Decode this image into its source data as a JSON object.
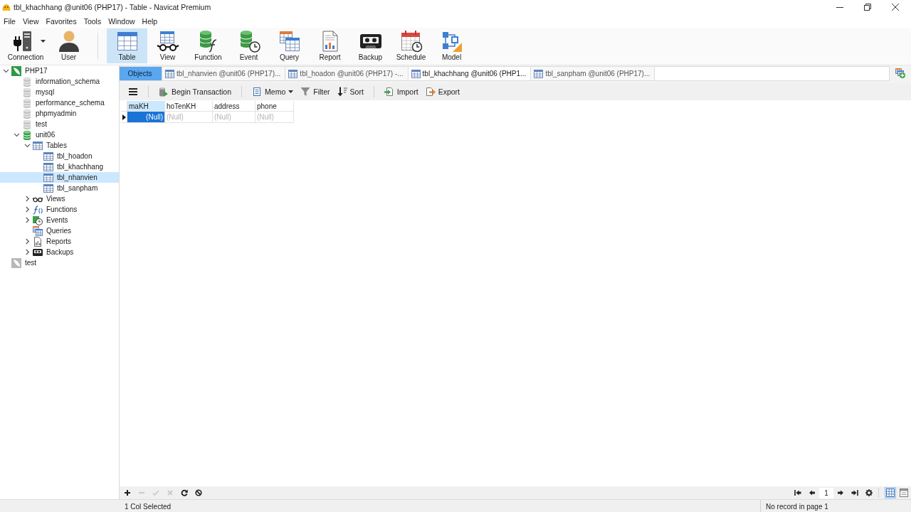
{
  "window": {
    "title": "tbl_khachhang @unit06 (PHP17) - Table - Navicat Premium"
  },
  "menu": [
    "File",
    "View",
    "Favorites",
    "Tools",
    "Window",
    "Help"
  ],
  "toolbar": {
    "groups": [
      [
        {
          "kind": "connection",
          "label": "Connection",
          "selected": false,
          "dropdown": true
        },
        {
          "kind": "user",
          "label": "User",
          "selected": false,
          "dropdown": false
        }
      ],
      [
        {
          "kind": "table",
          "label": "Table",
          "selected": true,
          "dropdown": false
        },
        {
          "kind": "view",
          "label": "View",
          "selected": false,
          "dropdown": false
        },
        {
          "kind": "function",
          "label": "Function",
          "selected": false,
          "dropdown": false
        },
        {
          "kind": "event",
          "label": "Event",
          "selected": false,
          "dropdown": false
        },
        {
          "kind": "query",
          "label": "Query",
          "selected": false,
          "dropdown": false
        },
        {
          "kind": "report",
          "label": "Report",
          "selected": false,
          "dropdown": false
        },
        {
          "kind": "backup",
          "label": "Backup",
          "selected": false,
          "dropdown": false
        },
        {
          "kind": "schedule",
          "label": "Schedule",
          "selected": false,
          "dropdown": false
        },
        {
          "kind": "model",
          "label": "Model",
          "selected": false,
          "dropdown": false
        }
      ]
    ]
  },
  "navigator": [
    {
      "label": "PHP17",
      "kind": "connection",
      "open": true,
      "expanded": true,
      "selected": false,
      "children": [
        {
          "label": "information_schema",
          "kind": "database",
          "open": false,
          "selected": false
        },
        {
          "label": "mysql",
          "kind": "database",
          "open": false,
          "selected": false
        },
        {
          "label": "performance_schema",
          "kind": "database",
          "open": false,
          "selected": false
        },
        {
          "label": "phpmyadmin",
          "kind": "database",
          "open": false,
          "selected": false
        },
        {
          "label": "test",
          "kind": "database",
          "open": false,
          "selected": false
        },
        {
          "label": "unit06",
          "kind": "database",
          "open": true,
          "expanded": true,
          "selected": false,
          "children": [
            {
              "label": "Tables",
              "kind": "tables",
              "expanded": true,
              "selected": false,
              "children": [
                {
                  "label": "tbl_hoadon",
                  "kind": "table",
                  "selected": false
                },
                {
                  "label": "tbl_khachhang",
                  "kind": "table",
                  "selected": false
                },
                {
                  "label": "tbl_nhanvien",
                  "kind": "table",
                  "selected": true
                },
                {
                  "label": "tbl_sanpham",
                  "kind": "table",
                  "selected": false
                }
              ]
            },
            {
              "label": "Views",
              "kind": "views",
              "expanded": false,
              "selected": false
            },
            {
              "label": "Functions",
              "kind": "functions",
              "expanded": false,
              "selected": false
            },
            {
              "label": "Events",
              "kind": "events",
              "expanded": false,
              "selected": false
            },
            {
              "label": "Queries",
              "kind": "queries",
              "selected": false
            },
            {
              "label": "Reports",
              "kind": "reports",
              "expanded": false,
              "selected": false
            },
            {
              "label": "Backups",
              "kind": "backups",
              "expanded": false,
              "selected": false
            }
          ]
        }
      ]
    },
    {
      "label": "test",
      "kind": "connection",
      "open": false,
      "selected": false
    }
  ],
  "tabs": [
    {
      "kind": "objects",
      "label": "Objects",
      "selected": false
    },
    {
      "kind": "table",
      "label": "tbl_nhanvien @unit06 (PHP17)...",
      "selected": false
    },
    {
      "kind": "table",
      "label": "tbl_hoadon @unit06 (PHP17) -...",
      "selected": false
    },
    {
      "kind": "table",
      "label": "tbl_khachhang @unit06 (PHP1...",
      "selected": true
    },
    {
      "kind": "table",
      "label": "tbl_sanpham @unit06 (PHP17)...",
      "selected": false
    }
  ],
  "data_toolbar": {
    "groups": [
      [
        {
          "kind": "menu"
        }
      ],
      [
        {
          "kind": "transaction",
          "label": "Begin Transaction",
          "dropdown": false
        }
      ],
      [
        {
          "kind": "memo",
          "label": "Memo",
          "dropdown": true
        },
        {
          "kind": "filter",
          "label": "Filter",
          "dropdown": false
        },
        {
          "kind": "sort",
          "label": "Sort",
          "dropdown": false
        }
      ],
      [
        {
          "kind": "import",
          "label": "Import",
          "dropdown": false
        },
        {
          "kind": "export",
          "label": "Export",
          "dropdown": false
        }
      ]
    ]
  },
  "grid": {
    "columns": [
      {
        "label": "maKH",
        "selected": true,
        "numeric": true
      },
      {
        "label": "hoTenKH",
        "selected": false,
        "numeric": false
      },
      {
        "label": "address",
        "selected": false,
        "numeric": false
      },
      {
        "label": "phone",
        "selected": false,
        "numeric": false
      }
    ],
    "rows": [
      {
        "current": true,
        "cells": [
          "(Null)",
          "(Null)",
          "(Null)",
          "(Null)"
        ]
      }
    ]
  },
  "record_bar": {
    "actions": [
      {
        "kind": "add",
        "disabled": false
      },
      {
        "kind": "delete",
        "disabled": true
      },
      {
        "kind": "apply",
        "disabled": true
      },
      {
        "kind": "cancel",
        "disabled": true
      },
      {
        "kind": "refresh",
        "disabled": false
      },
      {
        "kind": "stop",
        "disabled": false
      }
    ],
    "pager": [
      {
        "kind": "first"
      },
      {
        "kind": "previous"
      },
      {
        "kind": "page",
        "value": "1"
      },
      {
        "kind": "next"
      },
      {
        "kind": "last"
      },
      {
        "kind": "settings"
      }
    ],
    "views": [
      {
        "kind": "grid",
        "selected": true
      },
      {
        "kind": "form",
        "selected": false
      }
    ]
  },
  "status_bar": {
    "selection": "1 Col Selected",
    "records": "No record in page 1"
  }
}
